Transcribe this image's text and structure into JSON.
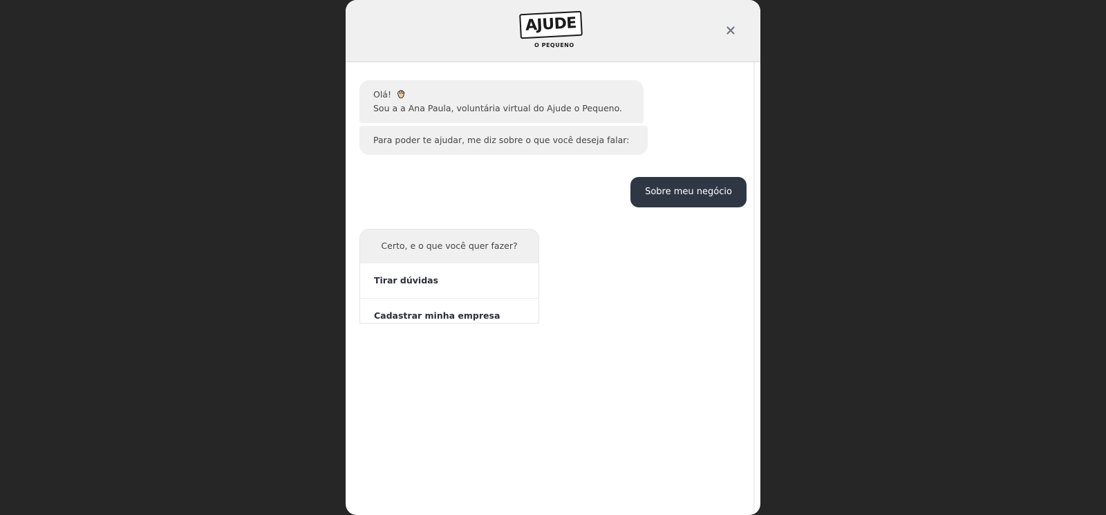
{
  "header": {
    "logo_word": "AJUDE",
    "logo_sub": "O PEQUENO",
    "close_glyph": "✕"
  },
  "messages": [
    {
      "from": "bot",
      "line1": "Olá!",
      "line2": "Sou a a Ana Paula, voluntária virtual do Ajude o Pequeno.",
      "icon": "waving-hand-icon"
    },
    {
      "from": "bot",
      "text": "Para poder te ajudar, me diz sobre o que você deseja falar:"
    },
    {
      "from": "user",
      "text": "Sobre meu negócio"
    }
  ],
  "options_card": {
    "question": "Certo, e o que você quer fazer?",
    "options": [
      {
        "label": "Tirar dúvidas"
      },
      {
        "label": "Cadastrar minha empresa"
      }
    ]
  },
  "colors": {
    "backdrop": "#262626",
    "header_bg": "#f0f0f0",
    "bot_bubble": "#f0f0f0",
    "user_bubble": "#2f3744",
    "text": "#444444"
  }
}
